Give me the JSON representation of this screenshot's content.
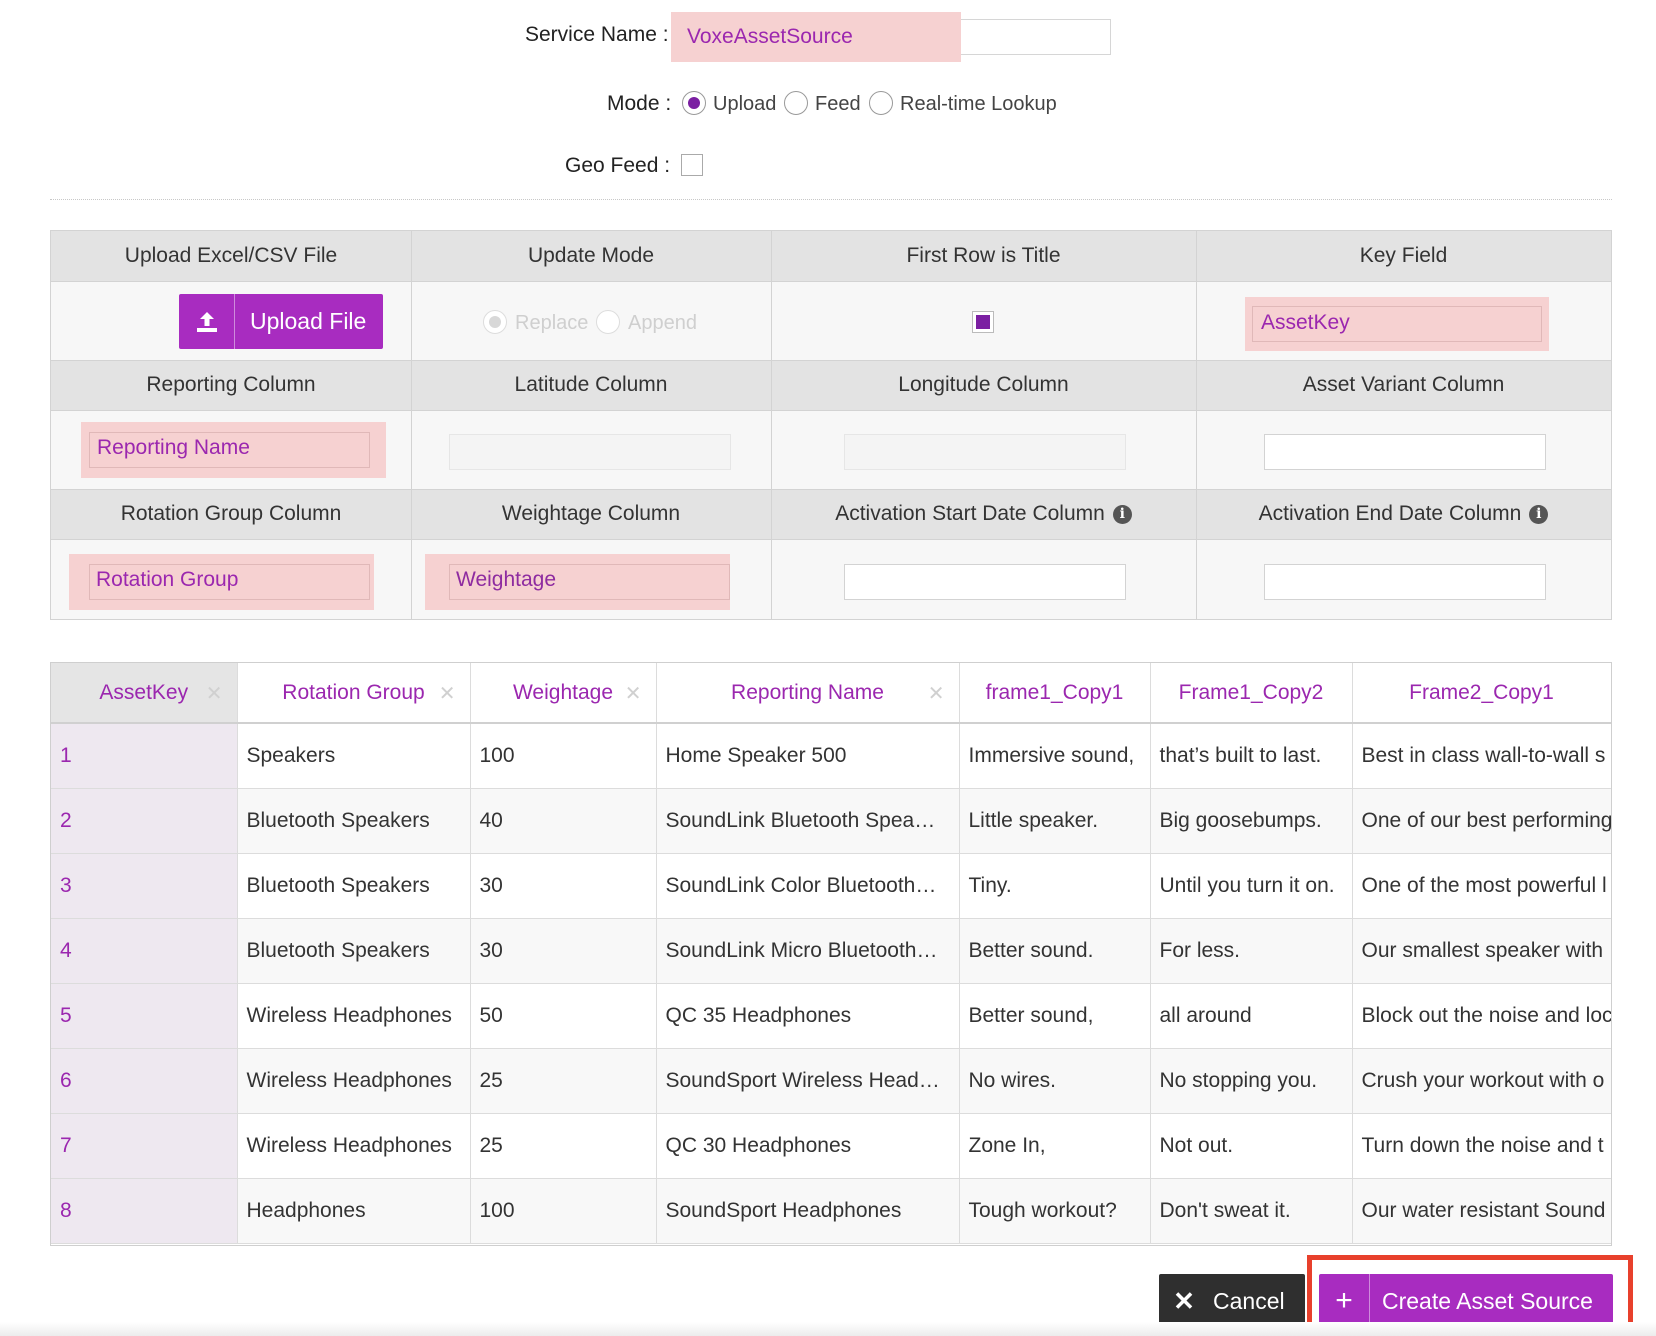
{
  "form": {
    "service_name_label": "Service Name :",
    "service_name_value": "VoxeAssetSource",
    "mode_label": "Mode :",
    "mode_options": [
      "Upload",
      "Feed",
      "Real-time Lookup"
    ],
    "mode_selected": "Upload",
    "geo_feed_label": "Geo Feed :",
    "geo_feed_checked": false
  },
  "settings": {
    "headers_row1": [
      "Upload Excel/CSV File",
      "Update Mode",
      "First Row is Title",
      "Key Field"
    ],
    "upload_button": "Upload File",
    "update_mode_options": [
      "Replace",
      "Append"
    ],
    "update_mode_selected": "Replace",
    "first_row_is_title": true,
    "key_field": "AssetKey",
    "headers_row2": [
      "Reporting Column",
      "Latitude Column",
      "Longitude Column",
      "Asset Variant Column"
    ],
    "reporting_column": "Reporting Name",
    "latitude_column": "",
    "longitude_column": "",
    "asset_variant_column": "",
    "headers_row3": [
      "Rotation Group Column",
      "Weightage Column",
      "Activation Start Date Column",
      "Activation End Date Column"
    ],
    "rotation_group_column": "Rotation Group",
    "weightage_column": "Weightage",
    "activation_start_date_column": "",
    "activation_end_date_column": ""
  },
  "table": {
    "columns": [
      "AssetKey",
      "Rotation Group",
      "Weightage",
      "Reporting Name",
      "frame1_Copy1",
      "Frame1_Copy2",
      "Frame2_Copy1"
    ],
    "rows": [
      [
        "1",
        "Speakers",
        "100",
        "Home Speaker 500",
        "Immersive sound,",
        "that’s built to last.",
        "Best in class wall-to-wall s"
      ],
      [
        "2",
        "Bluetooth Speakers",
        "40",
        "SoundLink Bluetooth Spea…",
        "Little speaker.",
        "Big goosebumps.",
        "One of our best performing"
      ],
      [
        "3",
        "Bluetooth Speakers",
        "30",
        "SoundLink Color Bluetooth…",
        "Tiny.",
        "Until you turn it on.",
        "One of the most powerful l"
      ],
      [
        "4",
        "Bluetooth Speakers",
        "30",
        "SoundLink Micro Bluetooth…",
        "Better sound.",
        "For less.",
        "Our smallest speaker with"
      ],
      [
        "5",
        "Wireless Headphones",
        "50",
        "QC 35 Headphones",
        "Better sound,",
        "all around",
        "Block out the noise and loc"
      ],
      [
        "6",
        "Wireless Headphones",
        "25",
        "SoundSport Wireless Head…",
        "No wires.",
        "No stopping you.",
        "Crush your workout with o"
      ],
      [
        "7",
        "Wireless Headphones",
        "25",
        "QC 30 Headphones",
        "Zone In,",
        "Not out.",
        "Turn down the noise and t"
      ],
      [
        "8",
        "Headphones",
        "100",
        "SoundSport Headphones",
        "Tough workout?",
        "Don't sweat it.",
        "Our water resistant Sound"
      ]
    ]
  },
  "actions": {
    "cancel": "Cancel",
    "create": "Create Asset Source"
  },
  "colors": {
    "accent": "#a82cc0",
    "highlight": "#f6d1d1",
    "annotation_outline": "#e8402c"
  }
}
